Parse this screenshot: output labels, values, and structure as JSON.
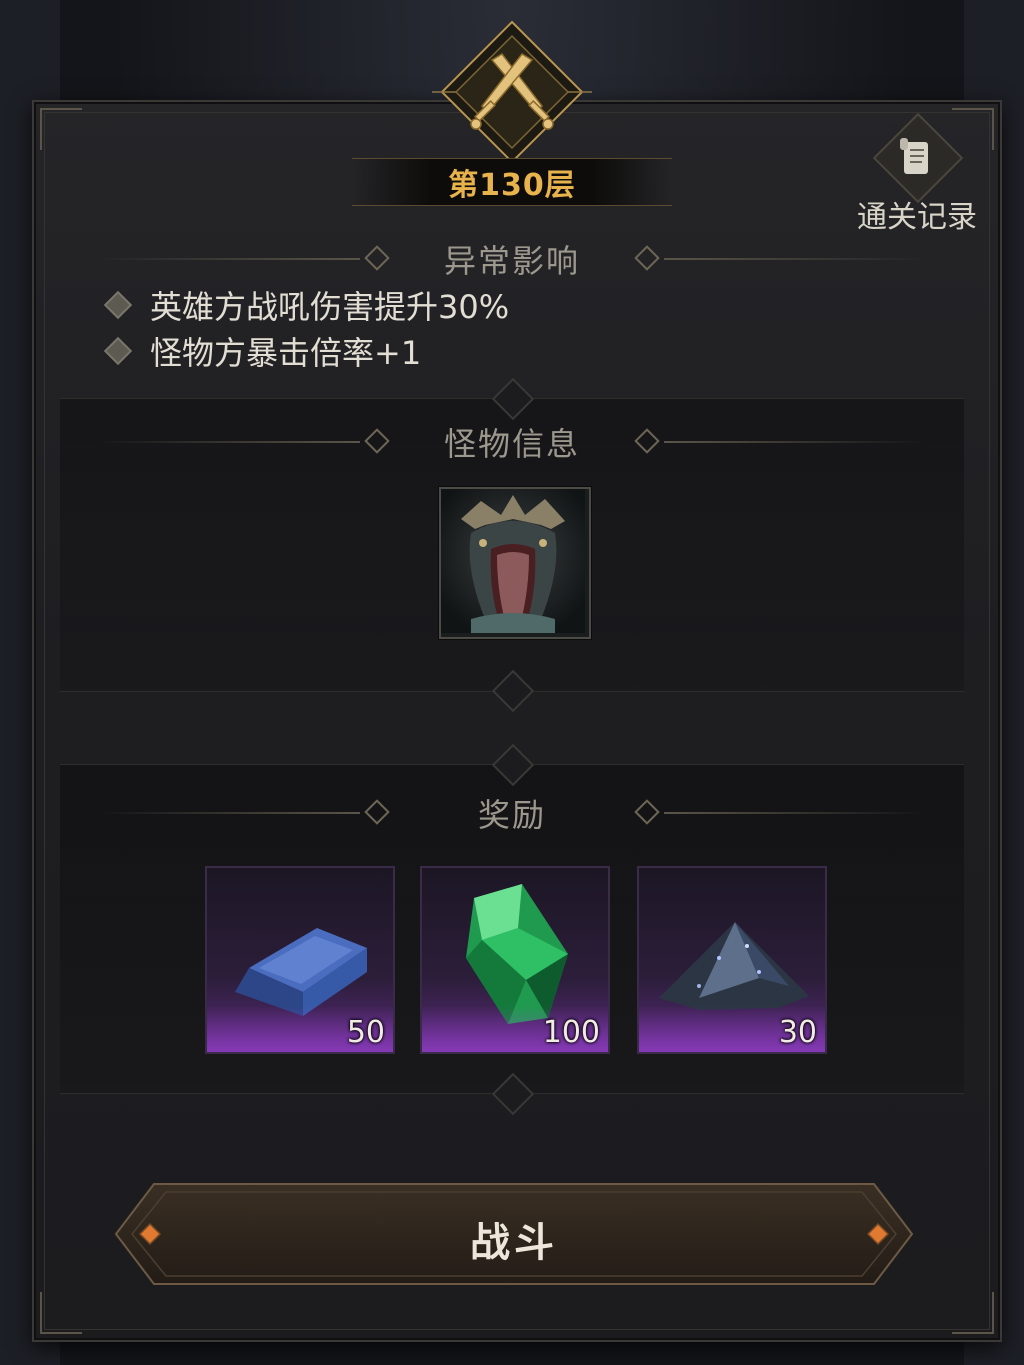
{
  "floor": {
    "title": "第130层"
  },
  "records": {
    "label": "通关记录",
    "icon": "scroll-icon"
  },
  "anomaly": {
    "title": "异常影响",
    "effects": [
      "英雄方战吼伤害提升30%",
      "怪物方暴击倍率+1"
    ]
  },
  "monster": {
    "title": "怪物信息",
    "portrait": "dragon-portrait"
  },
  "rewards": {
    "title": "奖励",
    "items": [
      {
        "name": "blue-ingot",
        "count": "50"
      },
      {
        "name": "green-crystal",
        "count": "100"
      },
      {
        "name": "dark-ore-pile",
        "count": "30"
      }
    ]
  },
  "fight": {
    "label": "战斗"
  },
  "colors": {
    "accent": "#e8b34c",
    "rarity": "#8a3fc0"
  }
}
